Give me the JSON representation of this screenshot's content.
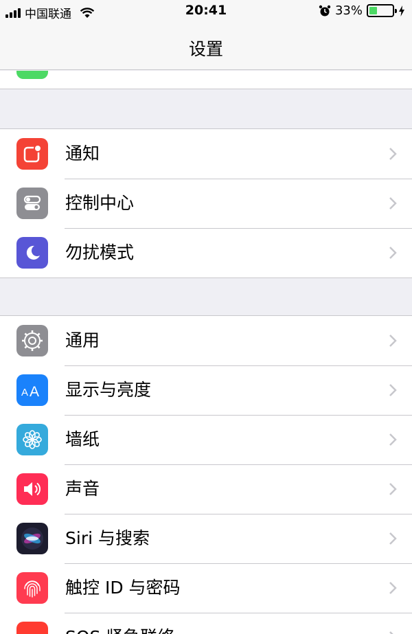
{
  "status_bar": {
    "carrier": "中国联通",
    "time": "20:41",
    "battery_percent": "33%",
    "battery_level": 0.33,
    "icons": [
      "signal-icon",
      "wifi-icon",
      "alarm-icon",
      "battery-icon",
      "charging-icon"
    ]
  },
  "nav": {
    "title": "设置"
  },
  "groups": [
    {
      "items": [
        {
          "label": "通知",
          "icon": "notifications-icon",
          "color": "#f44336"
        },
        {
          "label": "控制中心",
          "icon": "control-center-icon",
          "color": "#8e8e93"
        },
        {
          "label": "勿扰模式",
          "icon": "moon-icon",
          "color": "#5856d6"
        }
      ]
    },
    {
      "items": [
        {
          "label": "通用",
          "icon": "gear-icon",
          "color": "#8e8e93"
        },
        {
          "label": "显示与亮度",
          "icon": "display-icon",
          "color": "#1a82fb"
        },
        {
          "label": "墙纸",
          "icon": "wallpaper-icon",
          "color": "#35aadc"
        },
        {
          "label": "声音",
          "icon": "sound-icon",
          "color": "#ff2d55"
        },
        {
          "label": "Siri 与搜索",
          "icon": "siri-icon",
          "color": "#1c1c2e"
        },
        {
          "label": "触控 ID 与密码",
          "icon": "fingerprint-icon",
          "color": "#ff3b50"
        },
        {
          "label": "SOS 紧急联络",
          "icon": "sos-icon",
          "color": "#ff3b30"
        }
      ]
    }
  ]
}
